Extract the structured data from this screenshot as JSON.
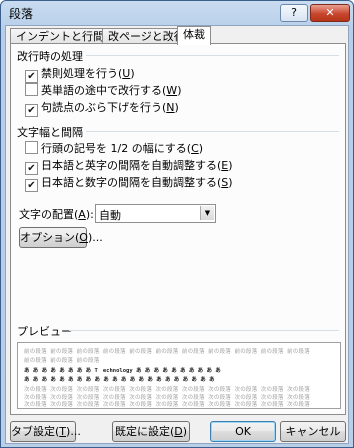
{
  "window": {
    "title": "段落",
    "help_label": "?",
    "close_label": "✕"
  },
  "tabs": [
    {
      "label": "インデントと行間隔"
    },
    {
      "label": "改ページと改行"
    },
    {
      "label": "体裁"
    }
  ],
  "line_break_section": {
    "title": "改行時の処理",
    "options": [
      {
        "text": "禁則処理を行う(",
        "key": "U",
        "suffix": ")",
        "checked": true
      },
      {
        "text": "英単語の途中で改行する(",
        "key": "W",
        "suffix": ")",
        "checked": false
      },
      {
        "text": "句読点のぶら下げを行う(",
        "key": "N",
        "suffix": ")",
        "checked": true
      }
    ]
  },
  "spacing_section": {
    "title": "文字幅と間隔",
    "options": [
      {
        "text": "行頭の記号を 1/2 の幅にする(",
        "key": "C",
        "suffix": ")",
        "checked": false
      },
      {
        "text": "日本語と英字の間隔を自動調整する(",
        "key": "E",
        "suffix": ")",
        "checked": true
      },
      {
        "text": "日本語と数字の間隔を自動調整する(",
        "key": "S",
        "suffix": ")",
        "checked": true
      }
    ],
    "alignment_label": "文字の配置(",
    "alignment_key": "A",
    "alignment_suffix": "):",
    "alignment_value": "自動",
    "options_button": {
      "text": "オプション(",
      "key": "O",
      "suffix": ")..."
    }
  },
  "preview": {
    "title": "プレビュー",
    "line_before_1": "前の段落 前の段落 前の段落 前の段落 前の段落 前の段落 前の段落 前の段落 前の段落 前の段落 前の段落",
    "line_before_2": "前の段落 前の段落 前の段落",
    "sample_line": "あ あ あ あ あ あ あ あ Tㅤechnology あ あ あ あ あ あ あ あ あ あ",
    "sample_line_2": "あ あ あ あ あ あ あ あ あ あ あ あ あ あ あ あ あ あ あ あ あ あ",
    "line_after_1": "次の段落 次の段落 次の段落 次の段落 次の段落 次の段落 次の段落 次の段落 次の段落 次の段落 次の段落",
    "line_after_2": "次の段落 次の段落 次の段落 次の段落 次の段落 次の段落 次の段落 次の段落 次の段落 次の段落 次の段落",
    "line_after_3": "次の段落 次の段落 次の段落 次の段落 次の段落 次の段落 次の段落 次の段落 次の段落 次の段落 次の段落"
  },
  "footer": {
    "tab_settings": {
      "text": "タブ設定(",
      "key": "T",
      "suffix": ")..."
    },
    "set_default": {
      "text": "既定に設定(",
      "key": "D",
      "suffix": ")"
    },
    "ok": "OK",
    "cancel": "キャンセル"
  }
}
